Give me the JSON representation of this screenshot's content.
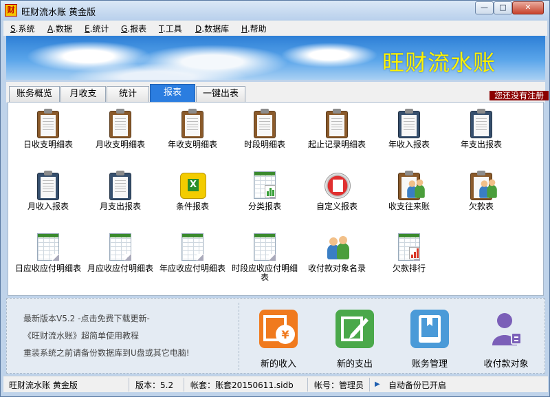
{
  "window": {
    "title": "旺财流水账 黄金版",
    "min": "—",
    "max": "□",
    "close": "✕"
  },
  "menu": [
    {
      "key": "S",
      "text": ".系统"
    },
    {
      "key": "A",
      "text": ".数据"
    },
    {
      "key": "E",
      "text": ".统计"
    },
    {
      "key": "G",
      "text": ".报表"
    },
    {
      "key": "T",
      "text": ".工具"
    },
    {
      "key": "D",
      "text": ".数据库"
    },
    {
      "key": "H",
      "text": ".帮助"
    }
  ],
  "banner": {
    "title": "旺财流水账"
  },
  "tabs": [
    "账务概览",
    "月收支",
    "统计",
    "报表",
    "一键出表"
  ],
  "active_tab": "报表",
  "notice": "您还没有注册",
  "reports": [
    {
      "label": "日收支明细表",
      "icon": "clipboard-icon"
    },
    {
      "label": "月收支明细表",
      "icon": "clipboard-icon"
    },
    {
      "label": "年收支明细表",
      "icon": "clipboard-icon"
    },
    {
      "label": "时段明细表",
      "icon": "clipboard-icon"
    },
    {
      "label": "起止记录明细表",
      "icon": "clipboard-icon"
    },
    {
      "label": "年收入报表",
      "icon": "clipboard-blue-icon"
    },
    {
      "label": "年支出报表",
      "icon": "clipboard-blue-icon"
    },
    {
      "label": "月收入报表",
      "icon": "clipboard-blue-icon"
    },
    {
      "label": "月支出报表",
      "icon": "clipboard-blue-icon"
    },
    {
      "label": "条件报表",
      "icon": "excel-icon"
    },
    {
      "label": "分类报表",
      "icon": "sheet-chart-icon"
    },
    {
      "label": "自定义报表",
      "icon": "custom-report-icon"
    },
    {
      "label": "收支往来账",
      "icon": "people-ledger-icon"
    },
    {
      "label": "欠款表",
      "icon": "people-ledger-icon"
    },
    {
      "label": "日应收应付明细表",
      "icon": "spreadsheet-icon"
    },
    {
      "label": "月应收应付明细表",
      "icon": "spreadsheet-icon"
    },
    {
      "label": "年应收应付明细表",
      "icon": "spreadsheet-icon"
    },
    {
      "label": "时段应收应付明细表",
      "icon": "spreadsheet-icon"
    },
    {
      "label": "收付款对象名录",
      "icon": "contacts-icon"
    },
    {
      "label": "欠款排行",
      "icon": "ranking-chart-icon"
    }
  ],
  "info": {
    "version_line": "最新版本V5.2  -点击免费下载更新-",
    "tutorial_line": "《旺财流水账》超简单使用教程",
    "backup_line": "重装系统之前请备份数据库到U盘或其它电脑!"
  },
  "actions": [
    {
      "label": "新的收入",
      "icon": "income-icon",
      "color": "#f07a1e"
    },
    {
      "label": "新的支出",
      "icon": "expense-edit-icon",
      "color": "#4aa84a"
    },
    {
      "label": "账务管理",
      "icon": "ledger-book-icon",
      "color": "#4a9ad8"
    },
    {
      "label": "收付款对象",
      "icon": "contact-person-icon",
      "color": "#7b5fb8"
    }
  ],
  "status": {
    "app": "旺财流水账 黄金版",
    "version": "版本：5.2",
    "book": "帐套：账套20150611.sidb",
    "account": "帐号：管理员",
    "backup": "自动备份已开启"
  }
}
